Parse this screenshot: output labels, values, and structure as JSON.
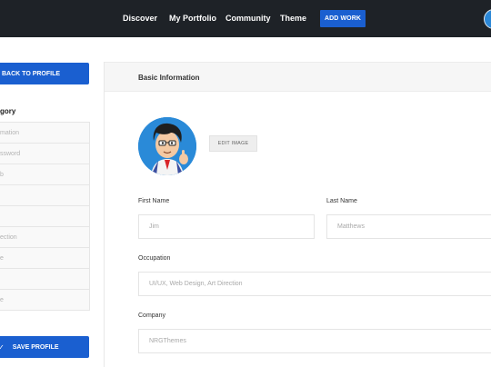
{
  "nav": {
    "links": [
      "Discover",
      "My Portfolio",
      "Community",
      "Theme"
    ],
    "add_work": "ADD WORK"
  },
  "sidebar": {
    "back_label": "BACK TO PROFILE",
    "category_title": "gory",
    "items": [
      "mation",
      "ssword",
      "b",
      "",
      "",
      "ection",
      "e",
      "",
      "e"
    ],
    "save_label": "SAVE PROFILE",
    "save_icon": "checkmark-icon"
  },
  "panel": {
    "title": "Basic Information",
    "edit_image": "EDIT IMAGE",
    "first_name_label": "First Name",
    "first_name_value": "Jim",
    "last_name_label": "Last Name",
    "last_name_value": "Matthews",
    "occupation_label": "Occupation",
    "occupation_value": "UI/UX, Web Design, Art Direction",
    "company_label": "Company",
    "company_value": "NRGThemes"
  },
  "colors": {
    "topbar": "#1e2227",
    "accent": "#1a5fd0"
  }
}
